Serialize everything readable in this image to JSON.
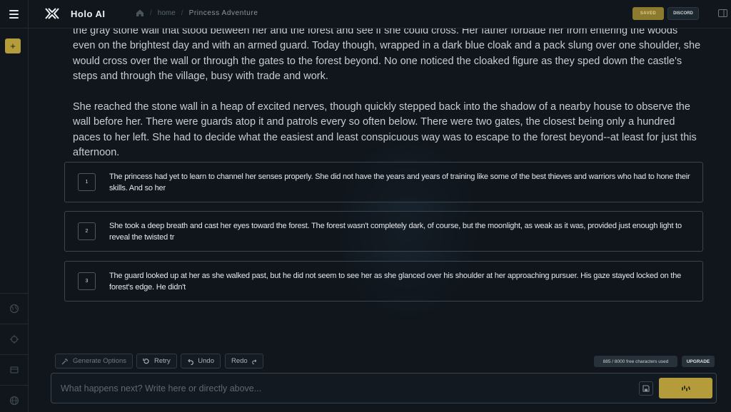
{
  "header": {
    "app_title": "Holo AI",
    "breadcrumb": {
      "home": "home",
      "current": "Princess Adventure"
    },
    "saved_label": "SAVED",
    "discord_label": "DISCORD"
  },
  "sidebar": {
    "add_label": "+",
    "icons": [
      "globe-icon",
      "target-icon",
      "cards-icon",
      "world-icon"
    ]
  },
  "story": {
    "paragraphs": [
      "the gray stone wall that stood between her and the forest and see if she could cross. Her father forbade her from entering the woods even on the brightest day and with an armed guard. Today though, wrapped in a dark blue cloak and a pack slung over one shoulder, she would cross over the wall or through the gates to the forest beyond. No one noticed the cloaked figure as they sped down the castle's steps and through the village, busy with trade and work.",
      "She reached the stone wall in a heap of excited nerves, though quickly stepped back into the shadow of a nearby house to observe the wall before her. There were guards atop it and patrols every so often below. There were two gates, the closest being only a hundred paces to her left. She had to decide what the easiest and least conspicuous way was to escape to the forest beyond--at least for just this afternoon."
    ]
  },
  "options": [
    {
      "num": "1",
      "text": "The princess had yet to learn to channel her senses properly. She did not have the years and years of training like some of the best thieves and warriors who had to hone their skills. And so her"
    },
    {
      "num": "2",
      "text": "She took a deep breath and cast her eyes toward the forest. The forest wasn't completely dark, of course, but the moonlight, as weak as it was, provided just enough light to reveal the twisted tr"
    },
    {
      "num": "3",
      "text": "The guard looked up at her as she walked past, but he did not seem to see her as she glanced over his shoulder at her approaching pursuer. His gaze stayed locked on the forest's edge. He didn't"
    }
  ],
  "controls": {
    "generate_options": "Generate Options",
    "retry": "Retry",
    "undo": "Undo",
    "redo": "Redo",
    "chars_used": "885 / 8000 free characters used",
    "upgrade": "UPGRADE"
  },
  "input": {
    "placeholder": "What happens next? Write here or directly above..."
  },
  "colors": {
    "accent": "#b59c3a",
    "background": "#10161c",
    "border": "#3a454f"
  }
}
